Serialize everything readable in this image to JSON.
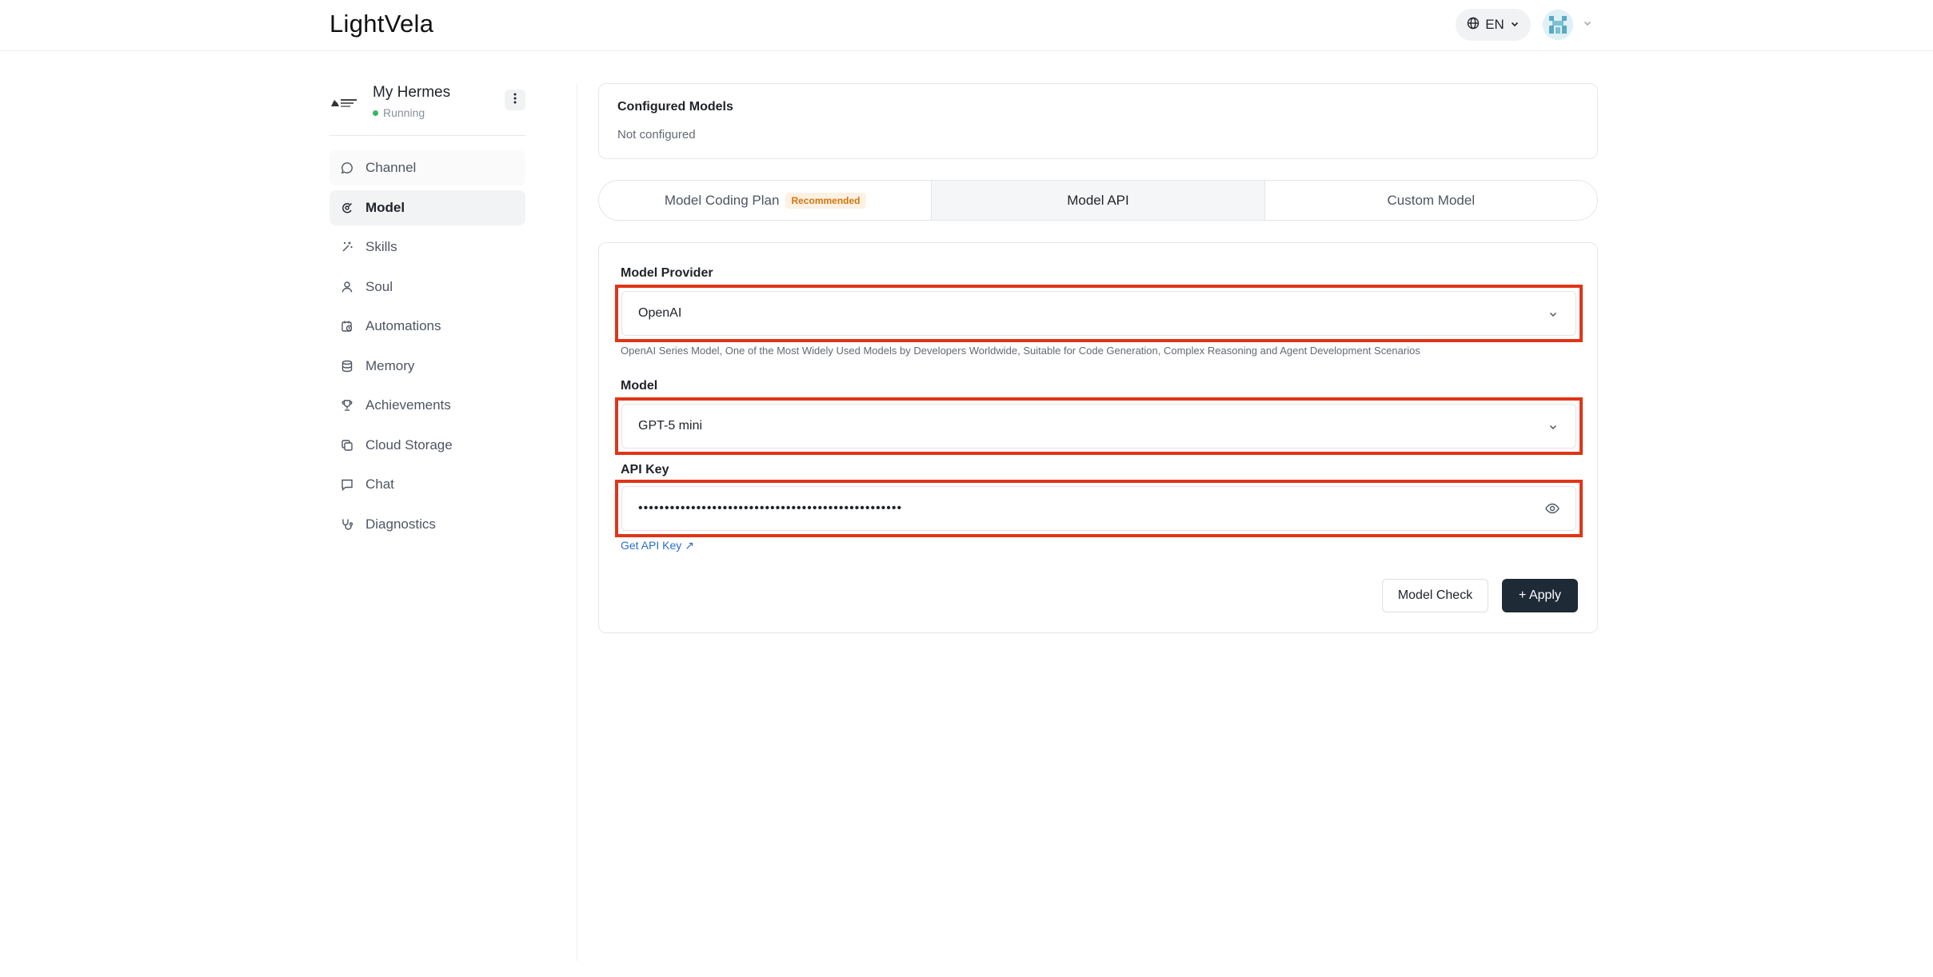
{
  "header": {
    "logo": "LightVela",
    "language": "EN"
  },
  "sidebar": {
    "agent_name": "My Hermes",
    "agent_status": "Running",
    "items": [
      {
        "label": "Channel",
        "icon": "chat-bubble-icon"
      },
      {
        "label": "Model",
        "icon": "model-icon"
      },
      {
        "label": "Skills",
        "icon": "sparkle-icon"
      },
      {
        "label": "Soul",
        "icon": "person-icon"
      },
      {
        "label": "Automations",
        "icon": "calendar-clock-icon"
      },
      {
        "label": "Memory",
        "icon": "database-icon"
      },
      {
        "label": "Achievements",
        "icon": "trophy-icon"
      },
      {
        "label": "Cloud Storage",
        "icon": "copy-files-icon"
      },
      {
        "label": "Chat",
        "icon": "message-square-icon"
      },
      {
        "label": "Diagnostics",
        "icon": "stethoscope-icon"
      }
    ],
    "active_item": "Model"
  },
  "configured_models": {
    "title": "Configured Models",
    "value": "Not configured"
  },
  "tabs": [
    {
      "label": "Model Coding Plan",
      "badge": "Recommended"
    },
    {
      "label": "Model API"
    },
    {
      "label": "Custom Model"
    }
  ],
  "active_tab": "Model API",
  "form": {
    "provider_label": "Model Provider",
    "provider_value": "OpenAI",
    "provider_hint": "OpenAI Series Model, One of the Most Widely Used Models by Developers Worldwide, Suitable for Code Generation, Complex Reasoning and Agent Development Scenarios",
    "model_label": "Model",
    "model_value": "GPT-5 mini",
    "api_key_label": "API Key",
    "api_key_value": "••••••••••••••••••••••••••••••••••••••••••••••••••",
    "get_key_link": "Get API Key ↗",
    "check_button": "Model Check",
    "apply_button": "+ Apply"
  },
  "colors": {
    "highlight": "#e03517",
    "primary_button": "#1f2a37",
    "link": "#2c6bd6",
    "status_running": "#2fb866",
    "badge_text": "#d2740d"
  }
}
